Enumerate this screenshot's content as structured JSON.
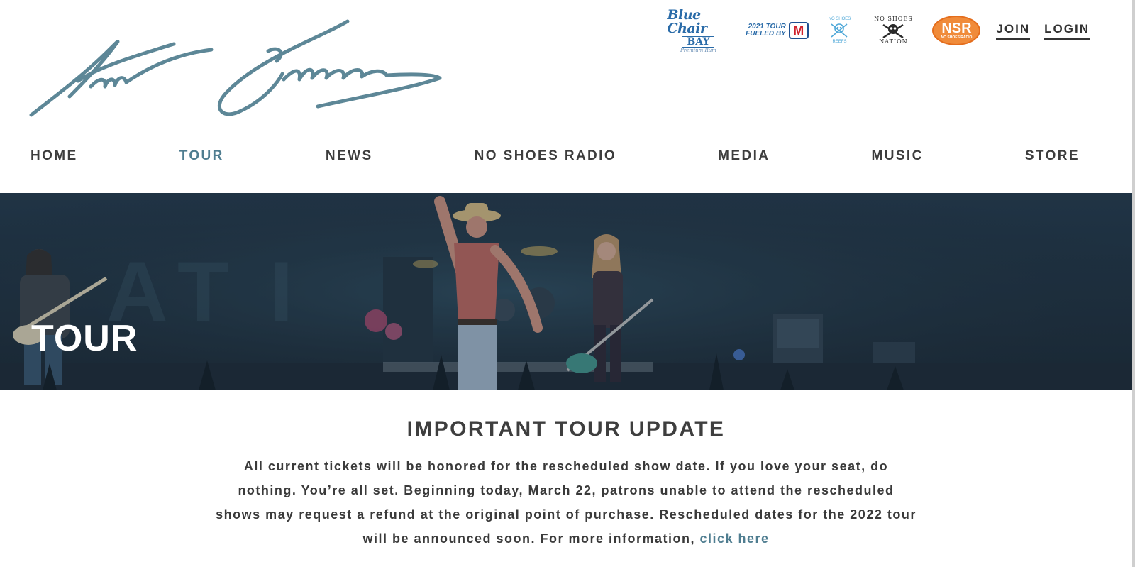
{
  "header": {
    "signature_logo": "Kenny Chesney",
    "sponsors": {
      "blue_chair": {
        "line1": "Blue Chair",
        "line2": "BAY",
        "line3": "Premium Rum"
      },
      "marathon": {
        "line1": "2021 TOUR",
        "line2": "FUELED BY",
        "badge": "M"
      },
      "reefs": {
        "top": "NO SHOES",
        "bottom": "REEFS"
      },
      "nation": {
        "top": "NO SHOES",
        "bottom": "NATION"
      },
      "nsr": {
        "main": "NSR",
        "sub": "NO SHOES RADIO"
      }
    },
    "account": {
      "join": "JOIN",
      "login": "LOGIN"
    }
  },
  "nav": {
    "items": [
      {
        "label": "HOME"
      },
      {
        "label": "TOUR",
        "active": true
      },
      {
        "label": "NEWS"
      },
      {
        "label": "NO SHOES RADIO"
      },
      {
        "label": "MEDIA"
      },
      {
        "label": "MUSIC"
      },
      {
        "label": "STORE"
      }
    ]
  },
  "hero": {
    "title": "TOUR"
  },
  "update": {
    "heading": "IMPORTANT TOUR UPDATE",
    "body": "All current tickets will be honored for the rescheduled show date. If you love your seat, do nothing. You’re all set. Beginning today, March 22, patrons unable to attend the rescheduled shows may request a refund at the original point of purchase. Rescheduled dates for the 2022 tour will be announced soon. For more information, ",
    "link_label": "click here"
  },
  "colors": {
    "accent": "#4f7d90",
    "text": "#3a3a3a",
    "hero_bg": "#1d2b38",
    "nsr_orange": "#f08b3a"
  }
}
